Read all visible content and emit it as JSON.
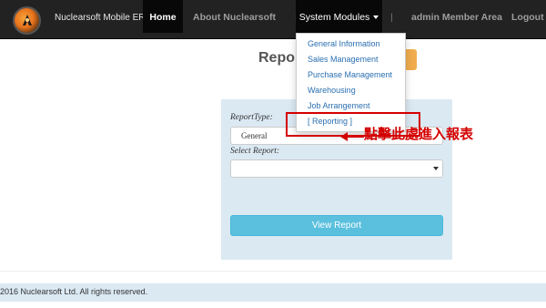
{
  "navbar": {
    "brand": "Nuclearsoft Mobile ERP",
    "home": "Home",
    "about": "About Nuclearsoft",
    "sep1": "|",
    "modules": "System Modules",
    "sep2": "|",
    "admin": "admin Member Area",
    "logout": "Logout"
  },
  "heading": "Repor",
  "dropdown": {
    "items": [
      "General Information",
      "Sales Management",
      "Purchase Management",
      "Warehousing",
      "Job Arrangement",
      "[ Reporting ]"
    ]
  },
  "callout": {
    "text": "點擊此處進入報表",
    "color": "#d40000"
  },
  "form": {
    "report_type_label": "ReportType:",
    "report_type_value": "General",
    "select_report_label": "Select Report:",
    "select_report_value": "",
    "view_button": "View Report"
  },
  "footer": {
    "text": "2016 Nuclearsoft Ltd. All rights reserved."
  },
  "icons": {
    "logo": "nuclearsoft-logo-icon",
    "modules_caret": "caret-down-icon",
    "select_arrow": "chevron-down-icon"
  },
  "colors": {
    "navbar": "#222222",
    "link": "#2a6fb0",
    "panel": "#dbe9f3",
    "button": "#5bc0de",
    "accent": "#f0ad4e"
  }
}
